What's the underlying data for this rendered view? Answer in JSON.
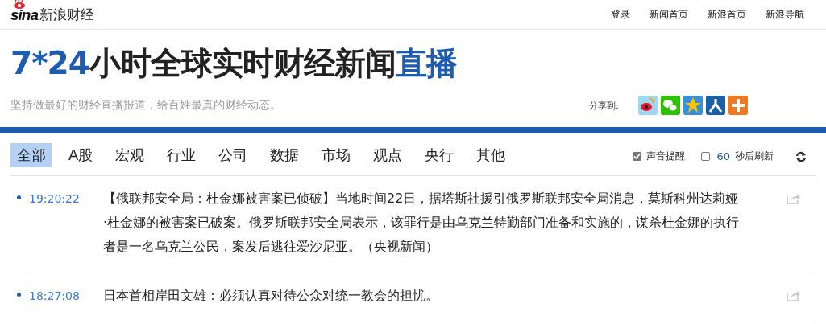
{
  "logo": {
    "mark": "sina",
    "name": "新浪财经"
  },
  "top_links": [
    "登录",
    "新闻首页",
    "新浪首页",
    "新浪导航"
  ],
  "headline": [
    {
      "text": "7*24",
      "kind": "accent"
    },
    {
      "text": "小时全球实时财经新闻",
      "kind": "plain"
    },
    {
      "text": "直播",
      "kind": "accent"
    }
  ],
  "subtitle": "坚持做最好的财经直播报道，给百姓最真的财经动态。",
  "share": {
    "label": "分享到:",
    "targets": [
      {
        "kind": "weibo"
      },
      {
        "kind": "wechat"
      },
      {
        "kind": "qzone"
      },
      {
        "kind": "renren"
      },
      {
        "kind": "more"
      }
    ]
  },
  "tabs": [
    {
      "label": "全部",
      "selected": true
    },
    {
      "label": "A股",
      "selected": false
    },
    {
      "label": "宏观",
      "selected": false
    },
    {
      "label": "行业",
      "selected": false
    },
    {
      "label": "公司",
      "selected": false
    },
    {
      "label": "数据",
      "selected": false
    },
    {
      "label": "市场",
      "selected": false
    },
    {
      "label": "观点",
      "selected": false
    },
    {
      "label": "央行",
      "selected": false
    },
    {
      "label": "其他",
      "selected": false
    }
  ],
  "sound_alert": {
    "label": "声音提醒",
    "checked": true
  },
  "auto_refresh": {
    "seconds": "60",
    "label": "秒后刷新",
    "checked": false
  },
  "feed": [
    {
      "time": "19:20:22",
      "text": "【俄联邦安全局：杜金娜被害案已侦破】当地时间22日，据塔斯社援引俄罗斯联邦安全局消息，莫斯科州达莉娅·杜金娜的被害案已破案。俄罗斯联邦安全局表示，该罪行是由乌克兰特勤部门准备和实施的，谋杀杜金娜的执行者是一名乌克兰公民，案发后逃往爱沙尼亚。（央视新闻）"
    },
    {
      "time": "18:27:08",
      "text": "日本首相岸田文雄：必须认真对待公众对统一教会的担忧。"
    }
  ]
}
